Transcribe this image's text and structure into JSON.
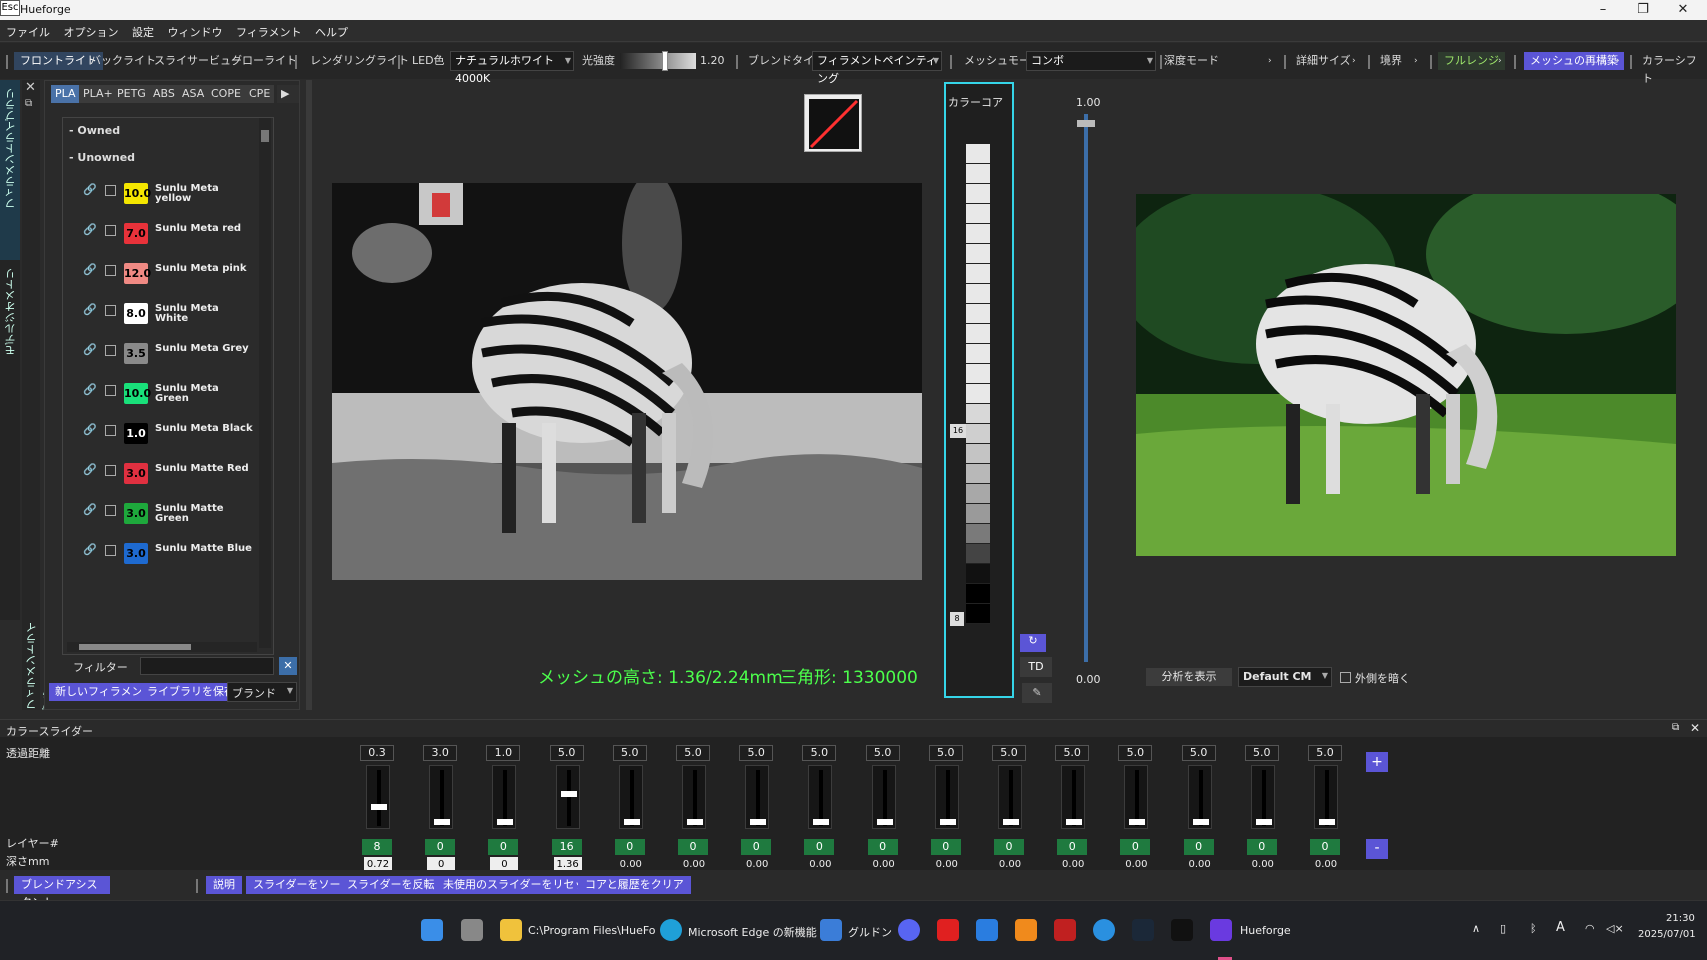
{
  "titlebar": {
    "esc": "Esc",
    "title": "Hueforge",
    "minimize": "–",
    "restore": "❐",
    "close": "✕"
  },
  "menu": [
    "ファイル",
    "オプション",
    "設定",
    "ウィンドウ",
    "フィラメント",
    "ヘルプ"
  ],
  "toolbar": {
    "front_light": "フロントライト",
    "back_light": "バックライト",
    "slider_view": "スライサービュー",
    "glow_light": "グローライト",
    "rendering_light": "レンダリングライト",
    "led_color_label": "LED色",
    "led_color_value": "ナチュラルホワイト4000K",
    "intensity_label": "光強度",
    "intensity_value": "1.20",
    "intensity_level": 0.6,
    "blend_type_label": "ブレンドタイプ",
    "blend_type_value": "フィラメントペインティング",
    "mesh_mode_label": "メッシュモード",
    "mesh_mode_value": "コンボ",
    "depth_mode": "深度モード",
    "detail_size": "詳細サイズ",
    "boundary": "境界",
    "full_range": "フルレンジ",
    "rebuild_mesh": "メッシュの再構築",
    "color_shift": "カラーシフト"
  },
  "left_strips": {
    "top_label": "フィラメントライブラリ",
    "mid_label": "モデルジオメトリ",
    "bottom_label": "フィラメントライブラリ"
  },
  "library": {
    "material_tabs": [
      "PLA",
      "PLA+",
      "PETG",
      "ABS",
      "ASA",
      "COPE",
      "CPE"
    ],
    "groups": {
      "owned": "- Owned",
      "unowned": "- Unowned"
    },
    "filaments": [
      {
        "td": "10.0",
        "name": "Sunlu Meta yellow",
        "color": "#f4e600",
        "text_color": "#000"
      },
      {
        "td": "7.0",
        "name": "Sunlu Meta red",
        "color": "#e8323a",
        "text_color": "#000"
      },
      {
        "td": "12.0",
        "name": "Sunlu Meta pink",
        "color": "#f08a84",
        "text_color": "#000"
      },
      {
        "td": "8.0",
        "name": "Sunlu Meta White",
        "color": "#ffffff",
        "text_color": "#000"
      },
      {
        "td": "3.5",
        "name": "Sunlu Meta Grey",
        "color": "#8a8a8a",
        "text_color": "#000"
      },
      {
        "td": "10.0",
        "name": "Sunlu Meta Green",
        "color": "#19e07a",
        "text_color": "#000"
      },
      {
        "td": "1.0",
        "name": "Sunlu Meta Black",
        "color": "#000000",
        "text_color": "#fff"
      },
      {
        "td": "3.0",
        "name": "Sunlu Matte Red",
        "color": "#e03040",
        "text_color": "#000"
      },
      {
        "td": "3.0",
        "name": "Sunlu Matte Green",
        "color": "#1ea83c",
        "text_color": "#000"
      },
      {
        "td": "3.0",
        "name": "Sunlu Matte Blue",
        "color": "#1e6ad0",
        "text_color": "#000"
      }
    ],
    "filter_label": "フィルター",
    "filter_value": "",
    "new_filament": "新しいフィラメント",
    "save_library": "ライブラリを保存",
    "brand": "ブランド"
  },
  "viewport": {
    "mesh_height": "メッシュの高さ: 1.36/2.24mm",
    "triangles": "三角形: 1330000"
  },
  "color_core": {
    "title": "カラーコア",
    "top_marker": "16",
    "bottom_marker": "8",
    "td_button": "TD"
  },
  "height_slider": {
    "max": "1.00",
    "min": "0.00"
  },
  "preview": {
    "show_analysis": "分析を表示",
    "cm_value": "Default CM",
    "darken_outside": "外側を暗く"
  },
  "color_sliders": {
    "title": "カラースライダー",
    "transmission_label": "透過距離",
    "layer_label": "レイヤー#",
    "depth_label": "深さmm",
    "columns": [
      {
        "td": "0.3",
        "layer": "8",
        "depth": "0.72",
        "boxed": true,
        "knob": 0.65
      },
      {
        "td": "3.0",
        "layer": "0",
        "depth": "0",
        "boxed": true,
        "knob": 0.95
      },
      {
        "td": "1.0",
        "layer": "0",
        "depth": "0",
        "boxed": true,
        "knob": 0.95
      },
      {
        "td": "5.0",
        "layer": "16",
        "depth": "1.36",
        "boxed": true,
        "knob": 0.4
      },
      {
        "td": "5.0",
        "layer": "0",
        "depth": "0.00",
        "boxed": false,
        "knob": 0.95
      },
      {
        "td": "5.0",
        "layer": "0",
        "depth": "0.00",
        "boxed": false,
        "knob": 0.95
      },
      {
        "td": "5.0",
        "layer": "0",
        "depth": "0.00",
        "boxed": false,
        "knob": 0.95
      },
      {
        "td": "5.0",
        "layer": "0",
        "depth": "0.00",
        "boxed": false,
        "knob": 0.95
      },
      {
        "td": "5.0",
        "layer": "0",
        "depth": "0.00",
        "boxed": false,
        "knob": 0.95
      },
      {
        "td": "5.0",
        "layer": "0",
        "depth": "0.00",
        "boxed": false,
        "knob": 0.95
      },
      {
        "td": "5.0",
        "layer": "0",
        "depth": "0.00",
        "boxed": false,
        "knob": 0.95
      },
      {
        "td": "5.0",
        "layer": "0",
        "depth": "0.00",
        "boxed": false,
        "knob": 0.95
      },
      {
        "td": "5.0",
        "layer": "0",
        "depth": "0.00",
        "boxed": false,
        "knob": 0.95
      },
      {
        "td": "5.0",
        "layer": "0",
        "depth": "0.00",
        "boxed": false,
        "knob": 0.95
      },
      {
        "td": "5.0",
        "layer": "0",
        "depth": "0.00",
        "boxed": false,
        "knob": 0.95
      },
      {
        "td": "5.0",
        "layer": "0",
        "depth": "0.00",
        "boxed": false,
        "knob": 0.95
      }
    ],
    "add": "+",
    "remove": "-"
  },
  "bottom_bar": {
    "blend_assistant": "ブレンドアシスタント",
    "description": "説明",
    "sort_sliders": "スライダーをソート",
    "invert_sliders": "スライダーを反転",
    "reset_unused": "未使用のスライダーをリセット",
    "clear_core": "コアと履歴をクリア"
  },
  "taskbar": {
    "explorer": "C:\\Program Files\\HueFo",
    "edge": "Microsoft Edge の新機能",
    "app3": "グルドン",
    "hueforge": "Hueforge",
    "lang": "A",
    "time": "21:30",
    "date": "2025/07/01"
  }
}
